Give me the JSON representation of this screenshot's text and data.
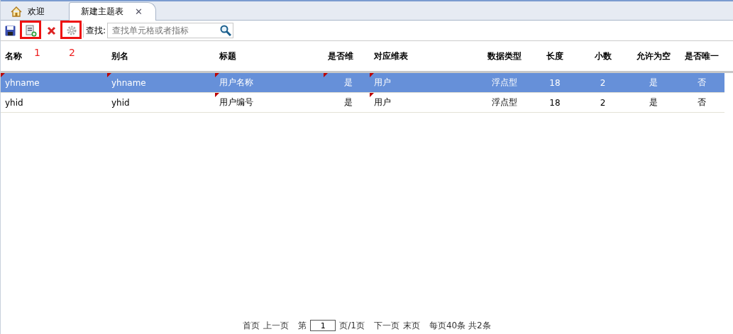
{
  "tabs": [
    {
      "label": "欢迎",
      "kind": "home",
      "selected": false
    },
    {
      "label": "新建主题表",
      "kind": "plain",
      "selected": true,
      "close": "✕"
    }
  ],
  "toolbar": {
    "search_label": "查找:",
    "search": {
      "placeholder": "查找单元格或者指标"
    }
  },
  "annotations": [
    "1",
    "2"
  ],
  "table": {
    "columns": [
      {
        "label": "名称"
      },
      {
        "label": "别名"
      },
      {
        "label": "标题"
      },
      {
        "label": "是否维"
      },
      {
        "label": "对应维表"
      },
      {
        "label": "数据类型"
      },
      {
        "label": "长度"
      },
      {
        "label": "小数"
      },
      {
        "label": "允许为空"
      },
      {
        "label": "是否唯一"
      }
    ],
    "rows": [
      {
        "selected": true,
        "cells": [
          {
            "text": "yhname",
            "flagged": true
          },
          {
            "text": "yhname",
            "flagged": true
          },
          {
            "text": "用户名称",
            "flagged": true
          },
          {
            "text": "是",
            "flagged": true
          },
          {
            "text": "用户",
            "flagged": true
          },
          {
            "text": "浮点型",
            "flagged": false
          },
          {
            "text": "18",
            "flagged": false
          },
          {
            "text": "2",
            "flagged": false
          },
          {
            "text": "是",
            "flagged": false
          },
          {
            "text": "否",
            "flagged": false
          }
        ]
      },
      {
        "selected": false,
        "cells": [
          {
            "text": "yhid",
            "flagged": false
          },
          {
            "text": "yhid",
            "flagged": false
          },
          {
            "text": "用户编号",
            "flagged": true
          },
          {
            "text": "是",
            "flagged": false
          },
          {
            "text": "用户",
            "flagged": true
          },
          {
            "text": "浮点型",
            "flagged": false
          },
          {
            "text": "18",
            "flagged": false
          },
          {
            "text": "2",
            "flagged": false
          },
          {
            "text": "是",
            "flagged": false
          },
          {
            "text": "否",
            "flagged": false
          }
        ]
      }
    ]
  },
  "pager": {
    "first": "首页",
    "prev": "上一页",
    "page_prefix": "第",
    "page": "1",
    "page_suffix": "页/1页",
    "next": "下一页",
    "last": "末页",
    "summary": "每页40条 共2条"
  }
}
